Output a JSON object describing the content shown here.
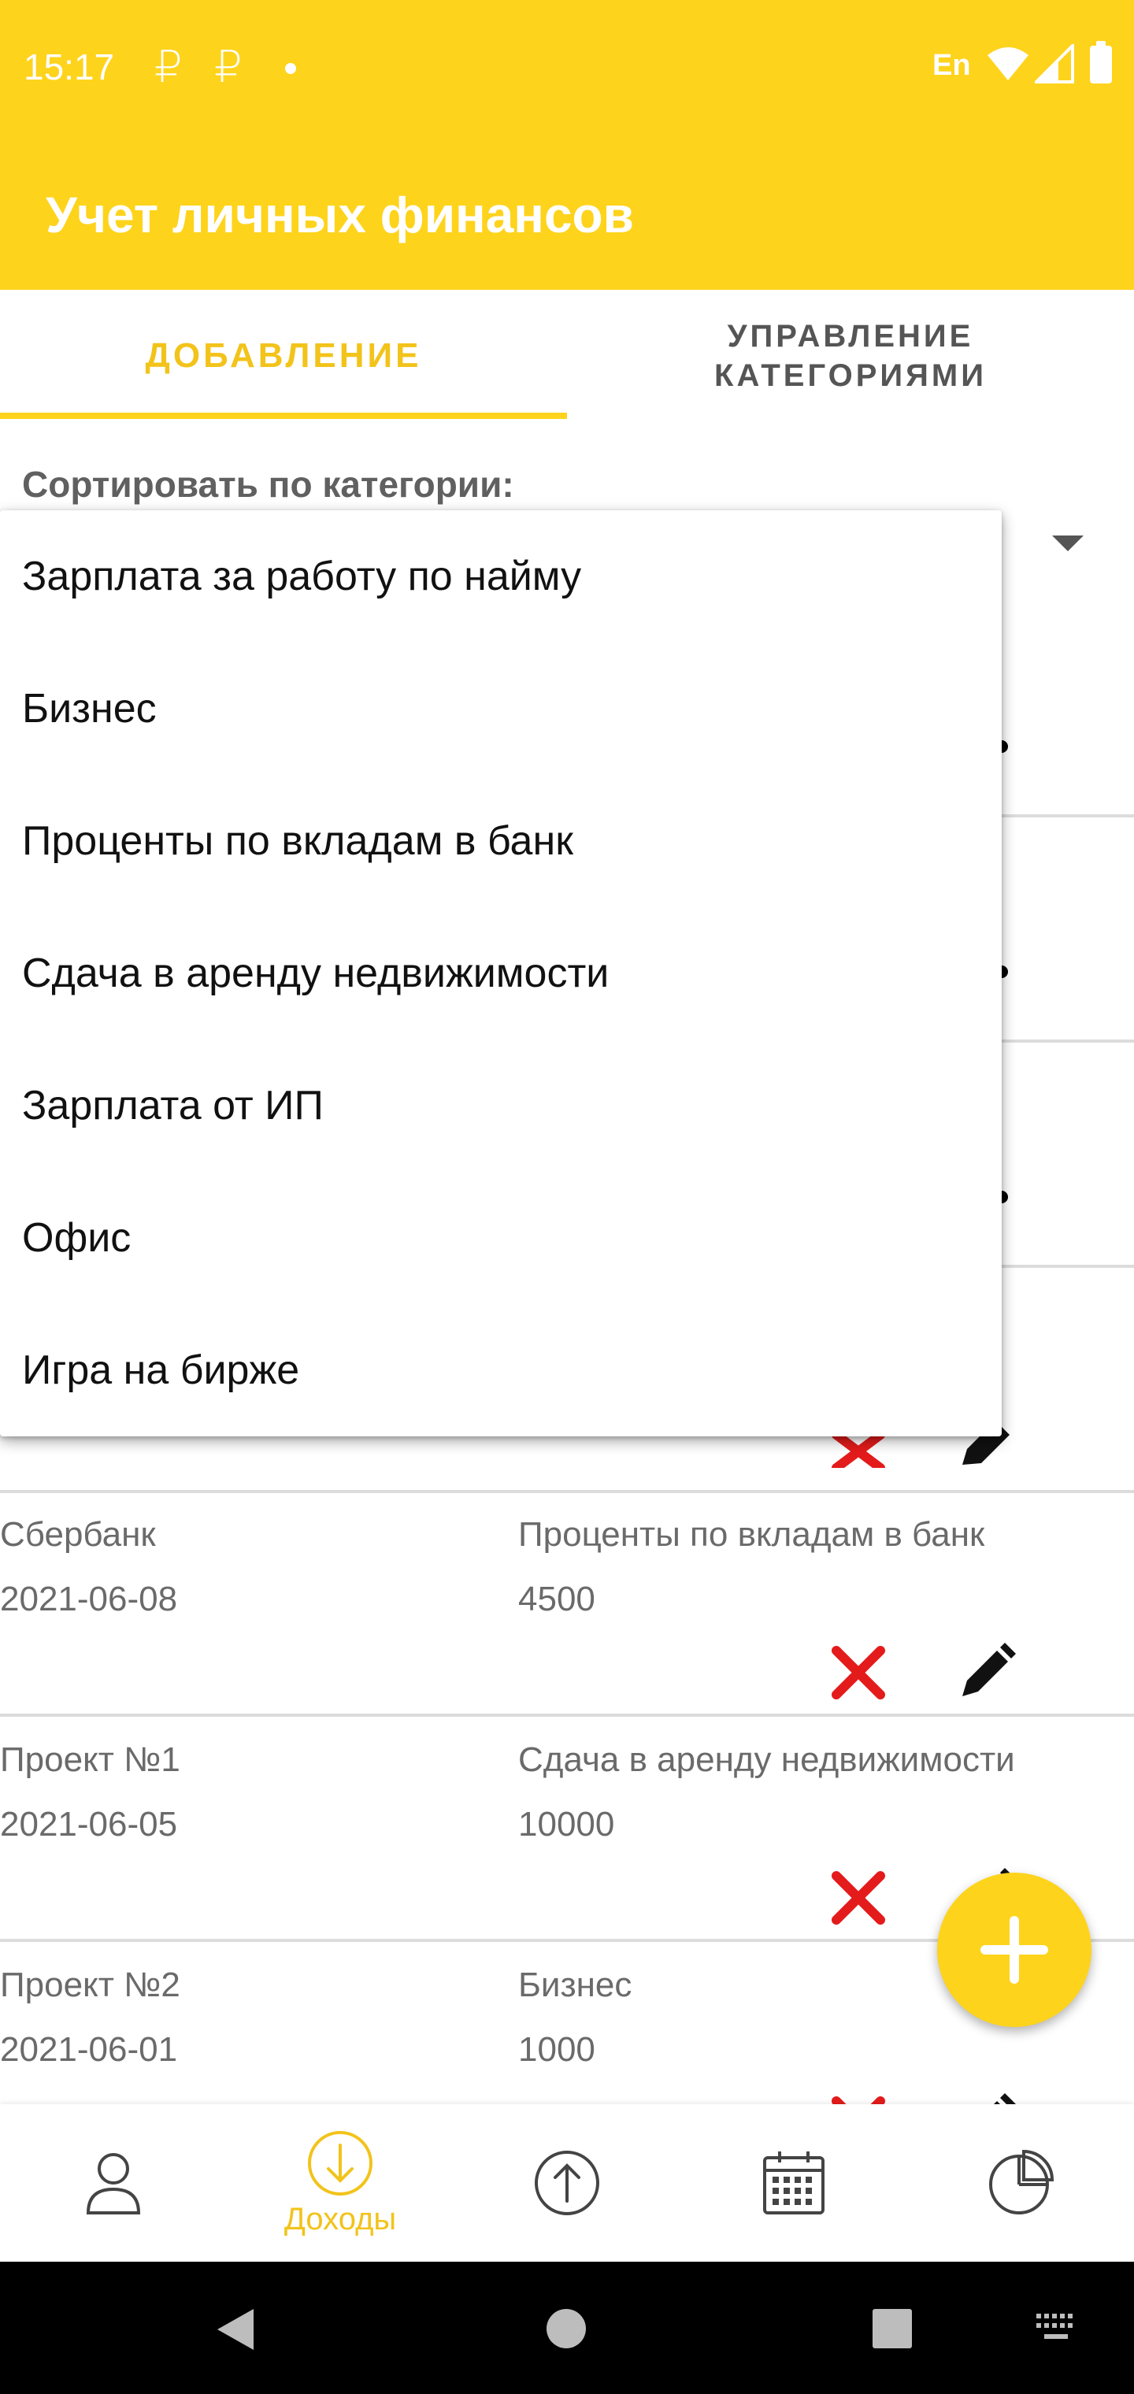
{
  "status_bar": {
    "time": "15:17",
    "currency_symbol": "₽",
    "language": "En"
  },
  "app_bar": {
    "title": "Учет личных финансов"
  },
  "tabs": [
    {
      "label": "ДОБАВЛЕНИЕ",
      "selected": true
    },
    {
      "label_line1": "УПРАВЛЕНИЕ",
      "label_line2": "КАТЕГОРИЯМИ",
      "selected": false
    }
  ],
  "sort": {
    "label": "Сортировать по категории:"
  },
  "dropdown": {
    "options": [
      "Зарплата за работу по найму",
      "Бизнес",
      "Проценты по вкладам в банк",
      "Сдача в аренду недвижимости",
      "Зарплата от ИП",
      "Офис",
      "Игра на бирже"
    ]
  },
  "entries": [
    {
      "name": "Сбербанк",
      "date": "2021-06-08",
      "category": "Проценты по вкладам в банк",
      "amount": "4500"
    },
    {
      "name": "Проект №1",
      "date": "2021-06-05",
      "category": "Сдача в аренду недвижимости",
      "amount": "10000"
    },
    {
      "name": "Проект №2",
      "date": "2021-06-01",
      "category": "Бизнес",
      "amount": "1000"
    }
  ],
  "bottom_nav": {
    "items": [
      {
        "icon": "person-icon",
        "label": ""
      },
      {
        "icon": "arrow-down-circle-icon",
        "label": "Доходы",
        "selected": true
      },
      {
        "icon": "arrow-up-circle-icon",
        "label": ""
      },
      {
        "icon": "calendar-icon",
        "label": ""
      },
      {
        "icon": "pie-chart-icon",
        "label": ""
      }
    ]
  },
  "colors": {
    "accent": "#FED31C",
    "accent_text": "#F2C31A",
    "delete": "#E41B1B"
  }
}
